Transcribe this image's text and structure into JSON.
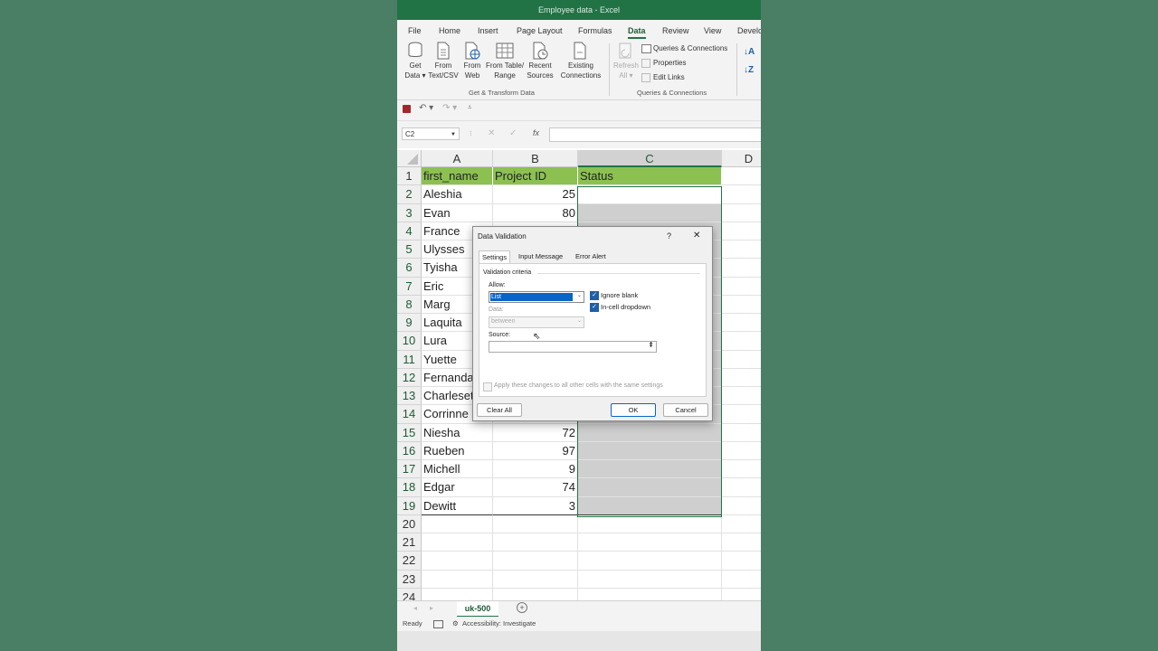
{
  "window": {
    "title": "Employee data  -  Excel"
  },
  "ribbon_tabs": [
    "File",
    "Home",
    "Insert",
    "Page Layout",
    "Formulas",
    "Data",
    "Review",
    "View",
    "Develo"
  ],
  "active_tab": "Data",
  "ribbon": {
    "get_data": "Get\nData ▾",
    "from_text": "From\nText/CSV",
    "from_web": "From\nWeb",
    "from_table": "From Table/\nRange",
    "recent_sources": "Recent\nSources",
    "existing_connections": "Existing\nConnections",
    "group1": "Get & Transform Data",
    "refresh_all": "Refresh\nAll ▾",
    "queries_connections": "Queries & Connections",
    "properties": "Properties",
    "edit_links": "Edit Links",
    "group2": "Queries & Connections"
  },
  "formula_bar": {
    "name_box": "C2",
    "fx": "fx"
  },
  "columns": [
    "A",
    "B",
    "C",
    "D"
  ],
  "rows": [
    {
      "n": "1",
      "a": "first_name",
      "b": "Project ID",
      "c": "Status"
    },
    {
      "n": "2",
      "a": "Aleshia",
      "b": "25",
      "c": ""
    },
    {
      "n": "3",
      "a": "Evan",
      "b": "80",
      "c": ""
    },
    {
      "n": "4",
      "a": "France",
      "b": "",
      "c": ""
    },
    {
      "n": "5",
      "a": "Ulysses",
      "b": "",
      "c": ""
    },
    {
      "n": "6",
      "a": "Tyisha",
      "b": "",
      "c": ""
    },
    {
      "n": "7",
      "a": "Eric",
      "b": "",
      "c": ""
    },
    {
      "n": "8",
      "a": "Marg",
      "b": "",
      "c": ""
    },
    {
      "n": "9",
      "a": "Laquita",
      "b": "",
      "c": ""
    },
    {
      "n": "10",
      "a": "Lura",
      "b": "",
      "c": ""
    },
    {
      "n": "11",
      "a": "Yuette",
      "b": "",
      "c": ""
    },
    {
      "n": "12",
      "a": "Fernanda",
      "b": "",
      "c": ""
    },
    {
      "n": "13",
      "a": "Charlesetta",
      "b": "",
      "c": ""
    },
    {
      "n": "14",
      "a": "Corrinne",
      "b": "",
      "c": ""
    },
    {
      "n": "15",
      "a": "Niesha",
      "b": "72",
      "c": ""
    },
    {
      "n": "16",
      "a": "Rueben",
      "b": "97",
      "c": ""
    },
    {
      "n": "17",
      "a": "Michell",
      "b": "9",
      "c": ""
    },
    {
      "n": "18",
      "a": "Edgar",
      "b": "74",
      "c": ""
    },
    {
      "n": "19",
      "a": "Dewitt",
      "b": "3",
      "c": ""
    },
    {
      "n": "20",
      "a": "",
      "b": "",
      "c": ""
    },
    {
      "n": "21",
      "a": "",
      "b": "",
      "c": ""
    },
    {
      "n": "22",
      "a": "",
      "b": "",
      "c": ""
    },
    {
      "n": "23",
      "a": "",
      "b": "",
      "c": ""
    },
    {
      "n": "24",
      "a": "",
      "b": "",
      "c": ""
    }
  ],
  "sheet_tab": "uk-500",
  "status": {
    "ready": "Ready",
    "accessibility": "Accessibility: Investigate"
  },
  "dialog": {
    "title": "Data Validation",
    "help": "?",
    "close": "✕",
    "tabs": [
      "Settings",
      "Input Message",
      "Error Alert"
    ],
    "criteria_label": "Validation criteria",
    "allow_label": "Allow:",
    "allow_value": "List",
    "data_label": "Data:",
    "data_value": "between",
    "ignore_blank": "Ignore blank",
    "in_cell_dropdown": "In-cell dropdown",
    "source_label": "Source:",
    "apply_all": "Apply these changes to all other cells with the same settings",
    "clear_all": "Clear All",
    "ok": "OK",
    "cancel": "Cancel"
  },
  "colors": {
    "excel_green": "#217346",
    "header_fill": "#8cc152",
    "background": "#4a7f66"
  }
}
